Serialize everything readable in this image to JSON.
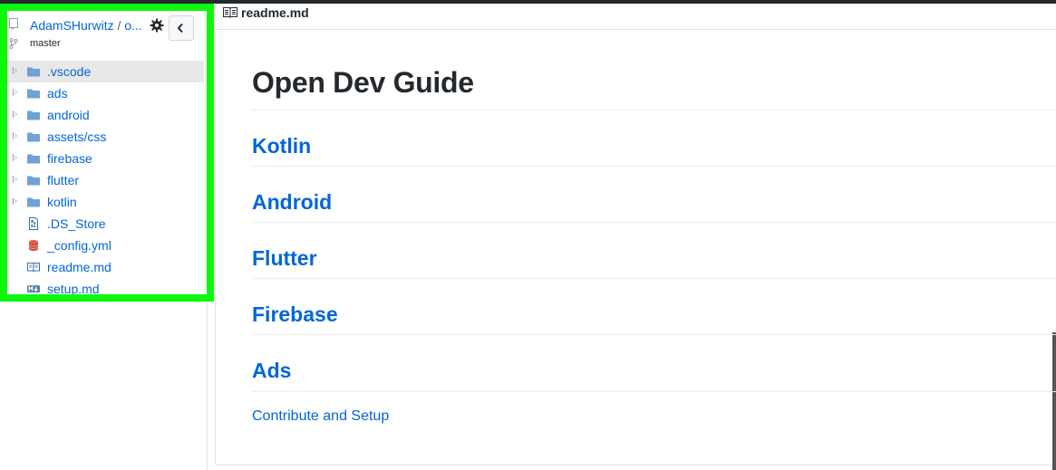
{
  "sidebar": {
    "repo": {
      "owner": "AdamSHurwitz",
      "separator": " / ",
      "name": "o..."
    },
    "branch": "master",
    "items": [
      {
        "label": ".vscode",
        "type": "folder",
        "icon": "folder-icon"
      },
      {
        "label": "ads",
        "type": "folder",
        "icon": "folder-icon"
      },
      {
        "label": "android",
        "type": "folder",
        "icon": "folder-icon"
      },
      {
        "label": "assets/css",
        "type": "folder",
        "icon": "folder-icon"
      },
      {
        "label": "firebase",
        "type": "folder",
        "icon": "folder-icon"
      },
      {
        "label": "flutter",
        "type": "folder",
        "icon": "folder-icon"
      },
      {
        "label": "kotlin",
        "type": "folder",
        "icon": "folder-icon"
      },
      {
        "label": ".DS_Store",
        "type": "file",
        "icon": "binary-file-icon"
      },
      {
        "label": "_config.yml",
        "type": "file",
        "icon": "database-file-icon"
      },
      {
        "label": "readme.md",
        "type": "file",
        "icon": "book-file-icon"
      },
      {
        "label": "setup.md",
        "type": "file",
        "icon": "markdown-file-icon"
      }
    ]
  },
  "file": {
    "name": "readme.md"
  },
  "readme": {
    "title": "Open Dev Guide",
    "sections": [
      "Kotlin",
      "Android",
      "Flutter",
      "Firebase",
      "Ads"
    ],
    "link": "Contribute and Setup"
  },
  "colors": {
    "link": "#0366d6",
    "highlight": "#0cf80c",
    "folder": "#79b8ff",
    "text": "#24292e"
  }
}
